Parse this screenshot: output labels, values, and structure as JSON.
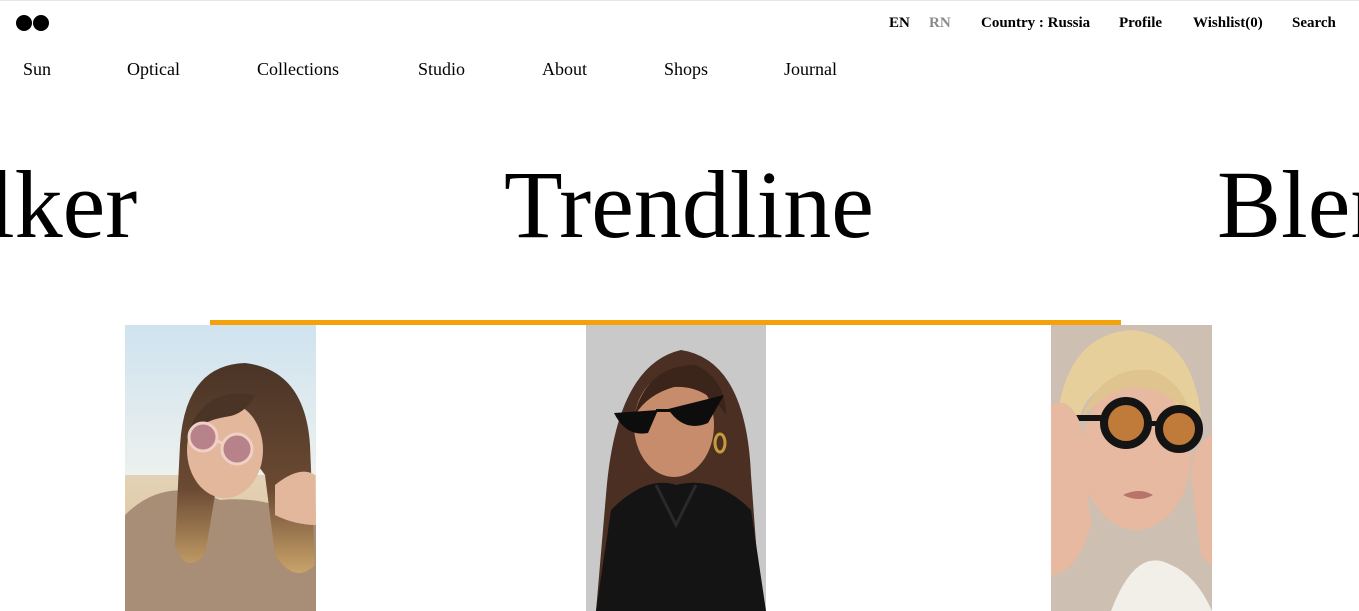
{
  "colors": {
    "accent": "#f5a20a",
    "text": "#000000",
    "muted": "#8a8a8a"
  },
  "logo": {
    "icon": "two-dots-logo-icon"
  },
  "utility_nav": {
    "lang_en": "EN",
    "lang_rn": "RN",
    "country": "Country : Russia",
    "profile": "Profile",
    "wishlist": "Wishlist(0)",
    "search": "Search"
  },
  "main_nav": {
    "items": [
      "Sun",
      "Optical",
      "Collections",
      "Studio",
      "About",
      "Shops",
      "Journal"
    ]
  },
  "collections_marquee": {
    "left": "lker",
    "center": "Trendline",
    "right": "Blen"
  },
  "products": [
    {
      "image": "woman-with-round-pink-tinted-sunglasses"
    },
    {
      "image": "woman-with-black-cat-eye-sunglasses"
    },
    {
      "image": "woman-with-black-round-sunglasses"
    }
  ]
}
